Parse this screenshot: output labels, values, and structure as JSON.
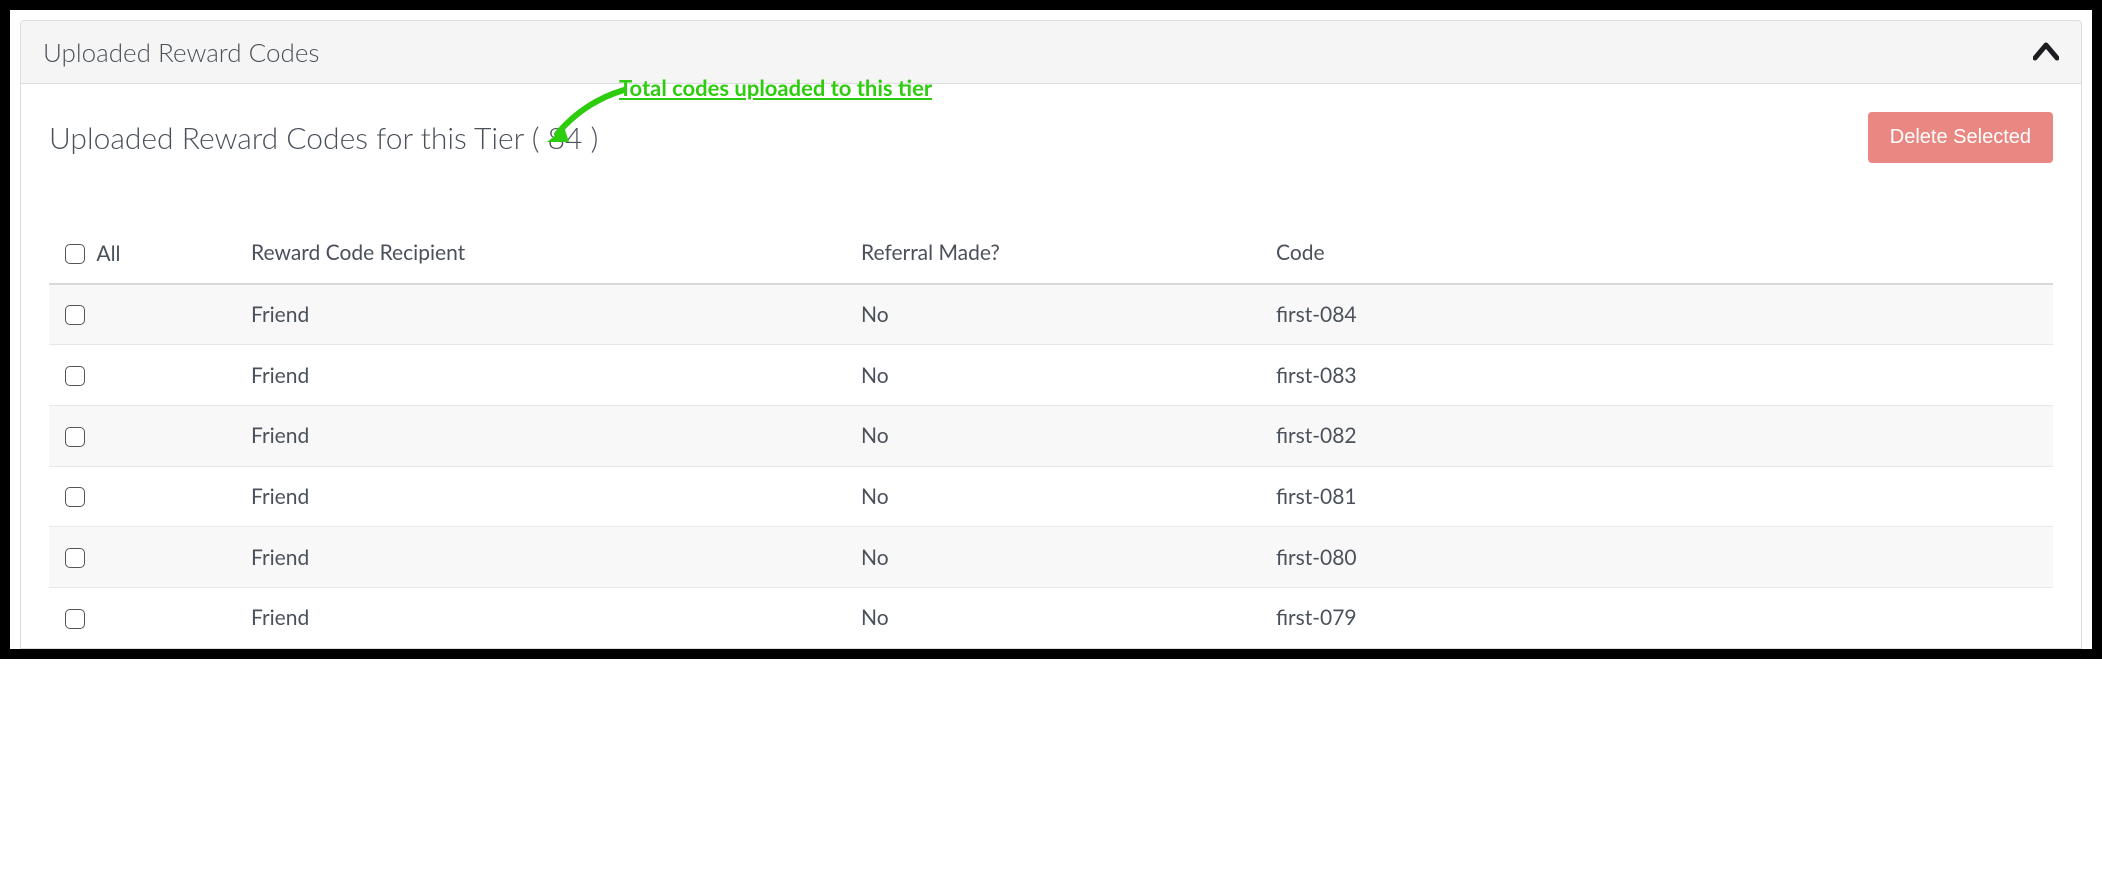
{
  "panel": {
    "heading": "Uploaded Reward Codes"
  },
  "tier": {
    "title_prefix": "Uploaded Reward Codes for this Tier ( ",
    "count": "84",
    "title_suffix": " )"
  },
  "annotation": {
    "text": "Total codes uploaded to this tier"
  },
  "buttons": {
    "delete_selected": "Delete Selected"
  },
  "table": {
    "headers": {
      "all": "All",
      "recipient": "Reward Code Recipient",
      "referral": "Referral Made?",
      "code": "Code"
    },
    "rows": [
      {
        "recipient": "Friend",
        "referral": "No",
        "code": "first-084"
      },
      {
        "recipient": "Friend",
        "referral": "No",
        "code": "first-083"
      },
      {
        "recipient": "Friend",
        "referral": "No",
        "code": "first-082"
      },
      {
        "recipient": "Friend",
        "referral": "No",
        "code": "first-081"
      },
      {
        "recipient": "Friend",
        "referral": "No",
        "code": "first-080"
      },
      {
        "recipient": "Friend",
        "referral": "No",
        "code": "first-079"
      }
    ]
  }
}
